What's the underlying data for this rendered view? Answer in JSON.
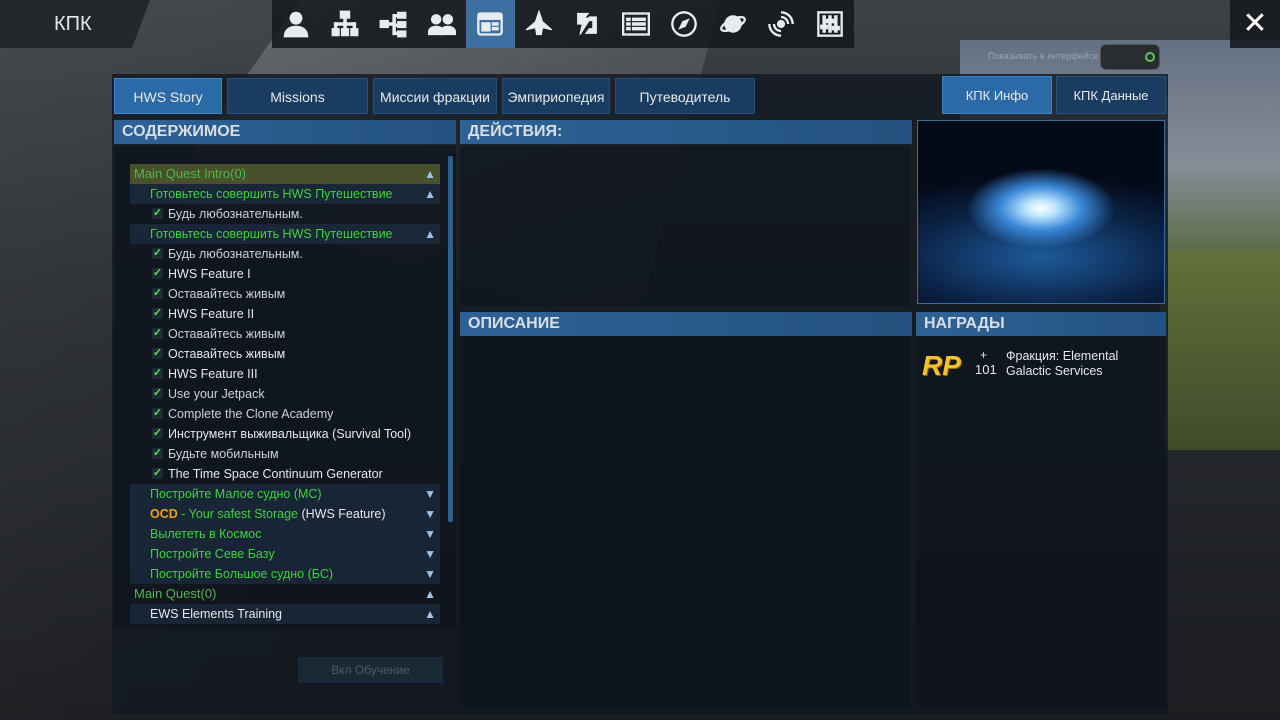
{
  "window": {
    "title": "КПК",
    "show_in_ui_label": "Показывать в интерфейсе"
  },
  "toolbar": {
    "icons": [
      "person-icon",
      "network-icon",
      "hierarchy-icon",
      "group-icon",
      "codex-icon",
      "ship-icon",
      "factory-icon",
      "list-icon",
      "compass-icon",
      "planet-icon",
      "galaxy-icon",
      "settings-sliders-icon"
    ],
    "active_index": 4,
    "close_label": "✕"
  },
  "tabs": {
    "left": [
      "HWS Story",
      "Missions",
      "Миссии фракции",
      "Эмпириопедия",
      "Путеводитель"
    ],
    "right": [
      "КПК Инфо",
      "КПК Данные"
    ]
  },
  "sections": {
    "contents": "СОДЕРЖИМОЕ",
    "actions": "ДЕЙСТВИЯ:",
    "description": "ОПИСАНИЕ",
    "rewards": "НАГРАДЫ"
  },
  "tree": {
    "cat1_label": "Main Quest Intro",
    "cat1_count": "(0)",
    "grp1": "Готовьтесь совершить HWS Путешествие",
    "grp1_item1": "Будь любознательным.",
    "grp2": "Готовьтесь совершить HWS Путешествие",
    "items": [
      "Будь любознательным.",
      "HWS Feature I",
      "Оставайтесь живым",
      "HWS Feature II",
      "Оставайтесь живым",
      "Оставайтесь живым",
      "HWS Feature III",
      "Use your Jetpack",
      "Complete the Clone Academy",
      "Инструмент выживальщика (Survival Tool)",
      "Будьте мобильным",
      "The Time Space Continuum Generator"
    ],
    "grp3": "Постройте Малое судно (МС)",
    "ocd_label": "OCD",
    "ocd_text": " - Your safest Storage ",
    "ocd_suffix": "(HWS Feature)",
    "grp5": "Вылететь в Космос",
    "grp6": "Постройте Севе Базу",
    "grp7": "Постройте Большое судно (БС)",
    "cat2_label": "Main Quest",
    "cat2_count": "(0)",
    "grp8": "EWS Elements Training"
  },
  "tutorial_button": "Вкл Обучение",
  "rewards": {
    "badge": "RP",
    "plus": "+",
    "value": "101",
    "text": "Фракция: Elemental Galactic Services"
  }
}
